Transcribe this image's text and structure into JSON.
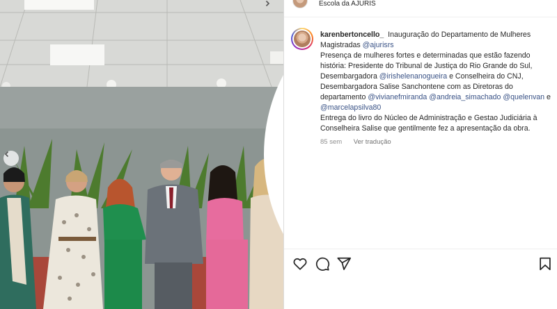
{
  "header": {
    "subtitle": "Escola da AJURIS"
  },
  "post": {
    "username": "karenbertoncello_",
    "line1": "Inauguração do Departamento de Mulheres Magistradas ",
    "mention1": "@ajurisrs",
    "line2": "Presença de mulheres fortes e determinadas que estão fazendo história: Presidente do Tribunal de Justiça do Rio Grande do Sul, Desembargadora ",
    "mention2": "@irishelenanogueira",
    "line3": " e Conselheira do CNJ, Desembargadora Salise Sanchontene com as Diretoras do departamento ",
    "mention3": "@vivianefmiranda",
    "mention4": "@andreia_simachado",
    "mention5": "@quelenvan",
    "and_text": " e ",
    "mention6": "@marcelapsilva80",
    "line4": "Entrega do livro do Núcleo de Administração e Gestao Judiciária à Conselheira Salise que gentilmente fez a apresentação da obra.",
    "age": "85 sem",
    "translate": "Ver tradução"
  },
  "icons": {
    "like": "heart-icon",
    "comment": "comment-icon",
    "share": "send-icon",
    "save": "bookmark-icon",
    "prev": "chevron-left-icon",
    "next": "chevron-right-icon"
  },
  "colors": {
    "mention": "#385185",
    "muted": "#8e8e8e",
    "text": "#262626"
  }
}
